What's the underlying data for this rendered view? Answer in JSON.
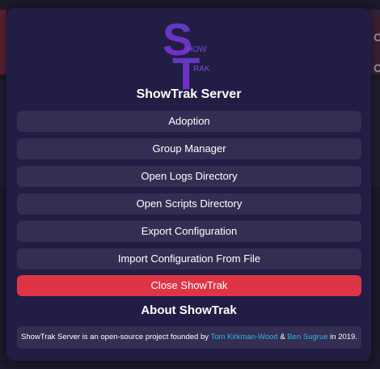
{
  "background": {
    "glyph_1": "C",
    "glyph_2": "C"
  },
  "logo": {
    "letter_s": "S",
    "letter_t": "T",
    "word_how": "HOW",
    "word_rak": "RAK",
    "colors": {
      "top": "#5a3eb8",
      "bottom": "#7a2ad0"
    }
  },
  "modal": {
    "title": "ShowTrak Server",
    "buttons": [
      {
        "label": "Adoption"
      },
      {
        "label": "Group Manager"
      },
      {
        "label": "Open Logs Directory"
      },
      {
        "label": "Open Scripts Directory"
      },
      {
        "label": "Export Configuration"
      },
      {
        "label": "Import Configuration From File"
      }
    ],
    "close_label": "Close ShowTrak",
    "about_title": "About ShowTrak",
    "about": {
      "prefix": "ShowTrak Server is an open-source project founded by ",
      "author_1": "Tom Kirkman-Wood",
      "conjunction": " & ",
      "author_2": "Ben Sugrue",
      "suffix": " in 2019."
    }
  },
  "colors": {
    "modal_bg": "#211d45",
    "button_bg": "#342e53",
    "danger": "#de3546",
    "link": "#29b6e6"
  }
}
